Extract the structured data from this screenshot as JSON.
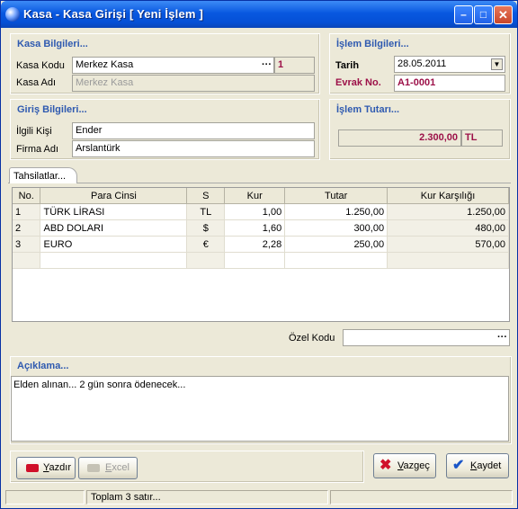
{
  "window": {
    "title": "Kasa - Kasa Girişi  [ Yeni İşlem ]"
  },
  "kasa": {
    "title": "Kasa Bilgileri...",
    "kod_label": "Kasa Kodu",
    "kod_value": "Merkez Kasa",
    "kod_suffix": "1",
    "ad_label": "Kasa Adı",
    "ad_value": "Merkez Kasa"
  },
  "islem": {
    "title": "İşlem Bilgileri...",
    "tarih_label": "Tarih",
    "tarih_value": "28.05.2011",
    "evrak_label": "Evrak No.",
    "evrak_value": "A1-0001"
  },
  "giris": {
    "title": "Giriş Bilgileri...",
    "kisi_label": "İlgili Kişi",
    "kisi_value": "Ender",
    "firma_label": "Firma Adı",
    "firma_value": "Arslantürk"
  },
  "tutar": {
    "title": "İşlem Tutarı...",
    "value": "2.300,00",
    "currency": "TL"
  },
  "tab": {
    "label": "Tahsilatlar..."
  },
  "grid": {
    "headers": [
      "No.",
      "Para Cinsi",
      "S",
      "Kur",
      "Tutar",
      "Kur Karşılığı"
    ],
    "rows": [
      [
        "1",
        "TÜRK LİRASI",
        "TL",
        "1,00",
        "1.250,00",
        "1.250,00"
      ],
      [
        "2",
        "ABD DOLARI",
        "$",
        "1,60",
        "300,00",
        "480,00"
      ],
      [
        "3",
        "EURO",
        "€",
        "2,28",
        "250,00",
        "570,00"
      ]
    ]
  },
  "ozel": {
    "label": "Özel Kodu"
  },
  "aciklama": {
    "title": "Açıklama...",
    "text": "Elden alınan... 2 gün sonra ödenecek..."
  },
  "buttons": {
    "yazdir_u": "Y",
    "yazdir_rest": "azdır",
    "excel_u": "E",
    "excel_rest": "xcel",
    "vazgec_u": "V",
    "vazgec_rest": "azgeç",
    "kaydet_u": "K",
    "kaydet_rest": "aydet"
  },
  "status": {
    "text": "Toplam 3 satır..."
  },
  "icons": [
    "app-icon",
    "minimize-icon",
    "maximize-icon",
    "close-icon",
    "printer-icon",
    "excel-icon",
    "cancel-x-icon",
    "check-icon"
  ],
  "colors": {
    "title_blue": "#2f5ab0",
    "accent_red": "#9c1048",
    "window_bg": "#ece9d8"
  }
}
